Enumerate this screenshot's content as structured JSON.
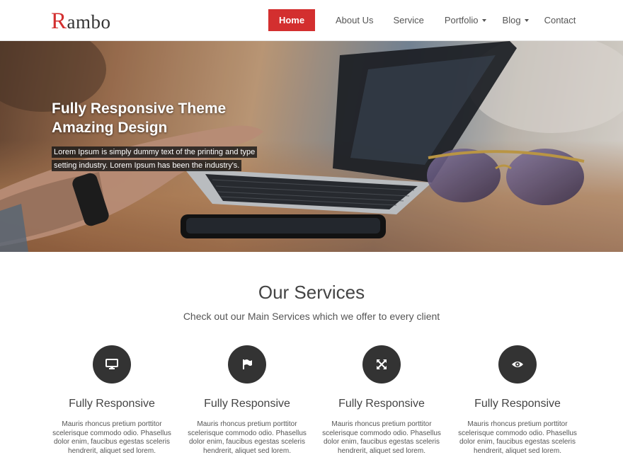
{
  "header": {
    "logo_first": "R",
    "logo_rest": "ambo",
    "nav": [
      {
        "label": "Home"
      },
      {
        "label": "About Us"
      },
      {
        "label": "Service"
      },
      {
        "label": "Portfolio"
      },
      {
        "label": "Blog"
      },
      {
        "label": "Contact"
      }
    ]
  },
  "hero": {
    "title_line1": "Fully Responsive Theme",
    "title_line2": "Amazing Design",
    "text": "Lorem Ipsum is simply dummy text of the printing and type setting industry. Lorem Ipsum has been the industry's."
  },
  "services": {
    "title": "Our Services",
    "subtitle": "Check out our Main Services which we offer to every client",
    "items": [
      {
        "icon": "monitor-icon",
        "title": "Fully Responsive",
        "text": "Mauris rhoncus pretium porttitor scelerisque commodo odio. Phasellus dolor enim, faucibus egestas sceleris hendrerit, aliquet sed lorem."
      },
      {
        "icon": "flag-icon",
        "title": "Fully Responsive",
        "text": "Mauris rhoncus pretium porttitor scelerisque commodo odio. Phasellus dolor enim, faucibus egestas sceleris hendrerit, aliquet sed lorem."
      },
      {
        "icon": "expand-icon",
        "title": "Fully Responsive",
        "text": "Mauris rhoncus pretium porttitor scelerisque commodo odio. Phasellus dolor enim, faucibus egestas sceleris hendrerit, aliquet sed lorem."
      },
      {
        "icon": "eye-icon",
        "title": "Fully Responsive",
        "text": "Mauris rhoncus pretium porttitor scelerisque commodo odio. Phasellus dolor enim, faucibus egestas sceleris hendrerit, aliquet sed lorem."
      }
    ]
  },
  "colors": {
    "accent": "#d32f2f",
    "icon_bg": "#333333"
  }
}
